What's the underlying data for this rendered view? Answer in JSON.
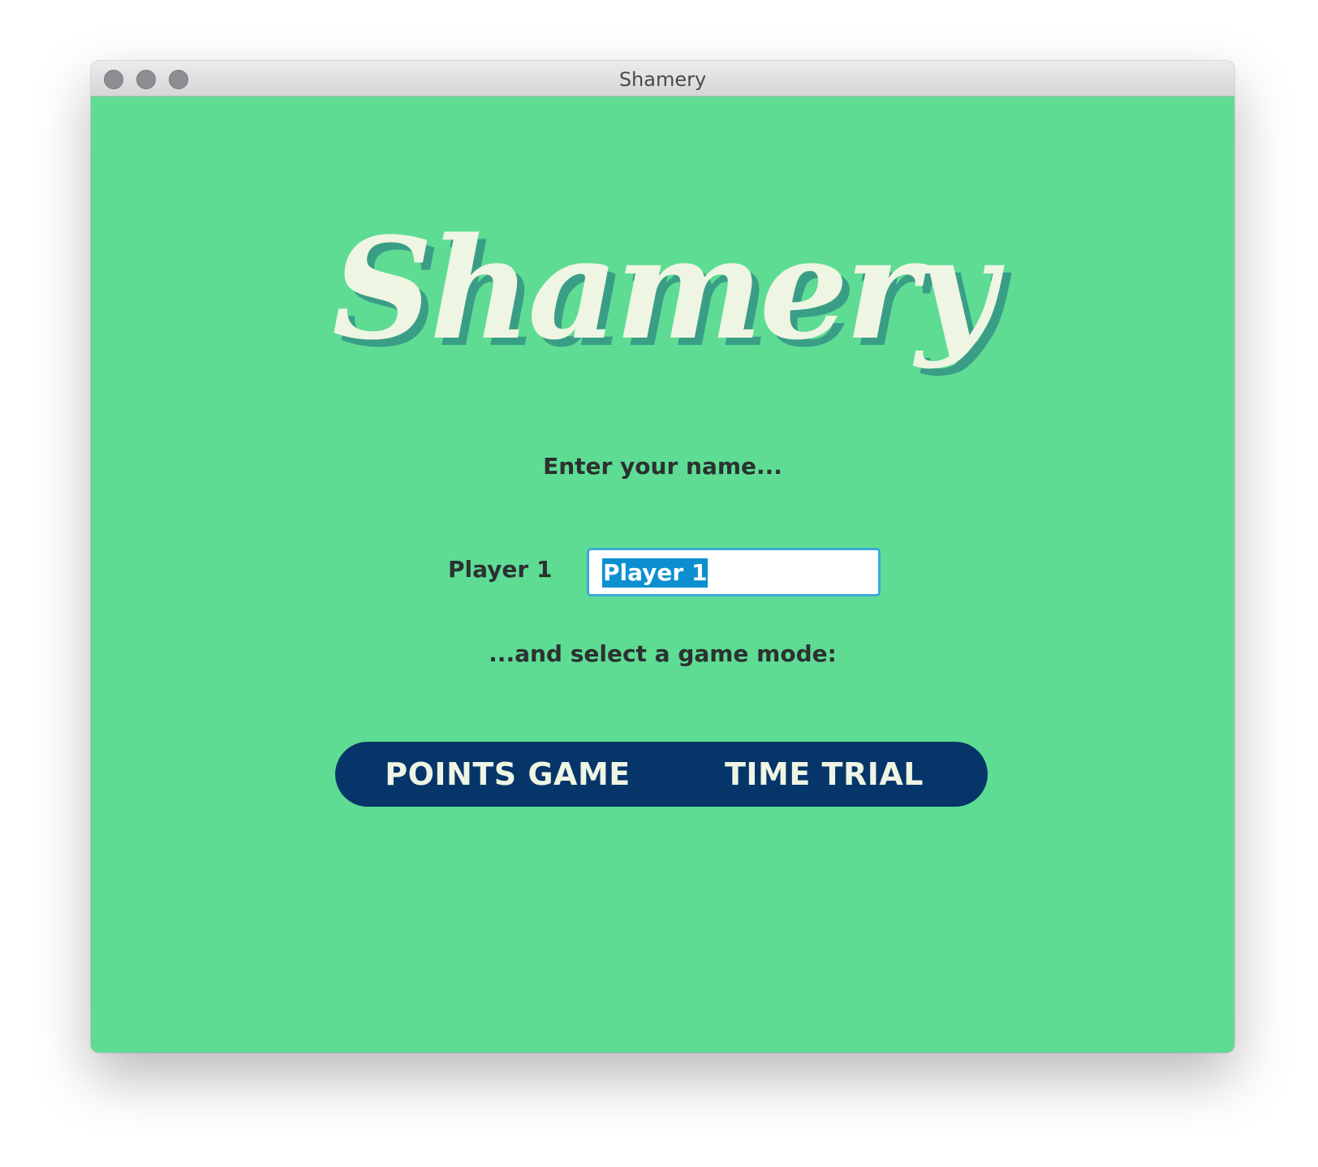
{
  "window": {
    "title": "Shamery"
  },
  "app": {
    "logo_text": "Shamery",
    "name_prompt": "Enter your name...",
    "player_label": "Player 1",
    "player_name_value": "Player 1",
    "mode_prompt": "...and select a game mode:",
    "modes": [
      {
        "label": "POINTS GAME"
      },
      {
        "label": "TIME TRIAL"
      }
    ]
  },
  "colors": {
    "background": "#5edc94",
    "logo_fill": "#eff5e3",
    "logo_shadow": "#3a9e86",
    "mode_bar": "#06356a",
    "text": "#2b3130",
    "selection": "#0b8fd1"
  }
}
